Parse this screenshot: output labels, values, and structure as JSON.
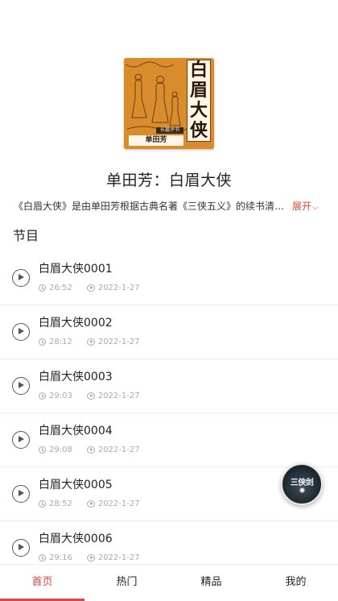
{
  "album": {
    "cover": {
      "title_chars": [
        "白",
        "眉",
        "大",
        "侠"
      ],
      "author_text": "单田芳",
      "series_text": "长篇评书",
      "accent_color": "#d98c2c"
    },
    "title": "单田芳：白眉大侠",
    "intro": "《白眉大侠》是由单田芳根据古典名著《三侠五义》的续书清末民初的《小五义》改编的评书",
    "expand_label": "展开"
  },
  "section_title": "节目",
  "episodes": [
    {
      "title": "白眉大侠0001",
      "duration": "26:52",
      "date": "2022-1-27"
    },
    {
      "title": "白眉大侠0002",
      "duration": "28:12",
      "date": "2022-1-27"
    },
    {
      "title": "白眉大侠0003",
      "duration": "29:03",
      "date": "2022-1-27"
    },
    {
      "title": "白眉大侠0004",
      "duration": "29:08",
      "date": "2022-1-27"
    },
    {
      "title": "白眉大侠0005",
      "duration": "28:52",
      "date": "2022-1-27"
    },
    {
      "title": "白眉大侠0006",
      "duration": "29:16",
      "date": "2022-1-27"
    }
  ],
  "floating_player": {
    "label": "三侠剑"
  },
  "tabs": [
    {
      "label": "首页",
      "active": true
    },
    {
      "label": "热门",
      "active": false
    },
    {
      "label": "精品",
      "active": false
    },
    {
      "label": "我的",
      "active": false
    }
  ],
  "colors": {
    "accent": "#e0443a"
  }
}
